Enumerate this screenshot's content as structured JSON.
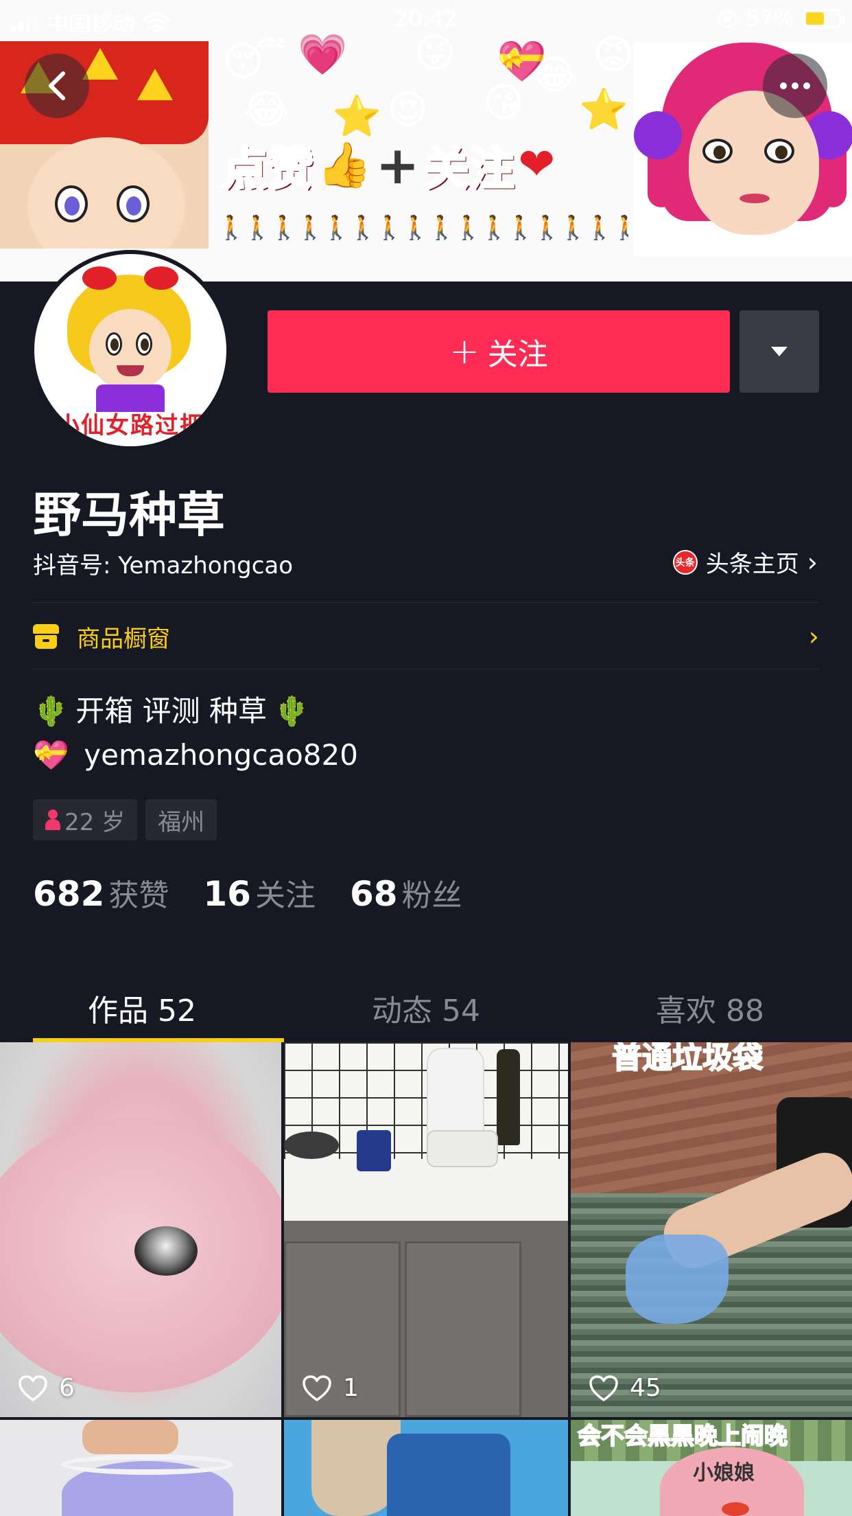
{
  "status_bar": {
    "carrier": "中国移动",
    "time": "20:42",
    "battery": "57%"
  },
  "banner": {
    "title_part1": "点赞",
    "title_plus": "+",
    "title_part2": "关注"
  },
  "avatar": {
    "caption": "小仙女路过把"
  },
  "actions": {
    "follow_label": "关注"
  },
  "profile": {
    "nickname": "野马种草",
    "douyin_id_label": "抖音号: Yemazhongcao",
    "toutiao_icon_text": "头条",
    "toutiao_link": "头条主页"
  },
  "shop": {
    "label": "商品橱窗"
  },
  "bio": {
    "line1": "开箱 评测 种草",
    "line2": "yemazhongcao820"
  },
  "tags": {
    "age": "22 岁",
    "city": "福州"
  },
  "stats": {
    "likes_count": "682",
    "likes_label": "获赞",
    "following_count": "16",
    "following_label": "关注",
    "followers_count": "68",
    "followers_label": "粉丝"
  },
  "tabs": [
    {
      "label": "作品 52"
    },
    {
      "label": "动态 54"
    },
    {
      "label": "喜欢 88"
    }
  ],
  "videos": [
    {
      "likes": "6"
    },
    {
      "likes": "1"
    },
    {
      "likes": "45",
      "caption": "普通垃圾袋"
    },
    {
      "caption": "会不会黑黑晚上闹晚"
    },
    {
      "duck_label": "小娘娘"
    }
  ],
  "colors": {
    "background": "#161823",
    "follow_button": "#fe2c55",
    "accent_yellow": "#face15",
    "muted_text": "#8a8b91"
  },
  "icons": {
    "back": "chevron-left-icon",
    "more": "more-dots-icon",
    "dropdown": "caret-down-icon",
    "shop": "shop-icon",
    "like": "heart-outline-icon"
  }
}
